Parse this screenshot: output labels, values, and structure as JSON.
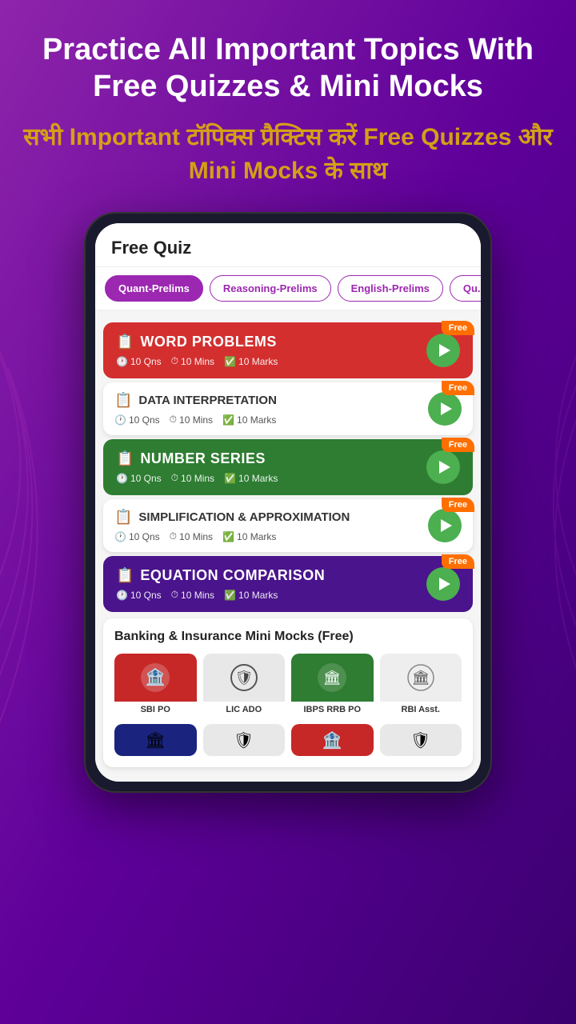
{
  "background": {
    "color_top": "#7b1fa2",
    "color_bottom": "#4a0080"
  },
  "header": {
    "headline_en": "Practice All Important Topics With Free Quizzes & Mini Mocks",
    "headline_hi": "सभी Important टॉपिक्स प्रैक्टिस करें Free Quizzes और Mini Mocks के साथ"
  },
  "phone": {
    "title": "Free Quiz",
    "tabs": [
      {
        "label": "Quant-Prelims",
        "active": true
      },
      {
        "label": "Reasoning-Prelims",
        "active": false
      },
      {
        "label": "English-Prelims",
        "active": false
      },
      {
        "label": "Qu...",
        "active": false
      }
    ],
    "quiz_items": [
      {
        "id": 1,
        "title": "WORD PROBLEMS",
        "style": "large-red",
        "qns": "10 Qns",
        "mins": "10 Mins",
        "marks": "10 Marks",
        "free": true
      },
      {
        "id": 2,
        "title": "DATA INTERPRETATION",
        "style": "small",
        "qns": "10 Qns",
        "mins": "10 Mins",
        "marks": "10 Marks",
        "free": true
      },
      {
        "id": 3,
        "title": "NUMBER SERIES",
        "style": "large-green",
        "qns": "10 Qns",
        "mins": "10 Mins",
        "marks": "10 Marks",
        "free": true
      },
      {
        "id": 4,
        "title": "SIMPLIFICATION & APPROXIMATION",
        "style": "small",
        "qns": "10 Qns",
        "mins": "10 Mins",
        "marks": "10 Marks",
        "free": true
      },
      {
        "id": 5,
        "title": "EQUATION COMPARISON",
        "style": "large-purple",
        "qns": "10 Qns",
        "mins": "10 Mins",
        "marks": "10 Marks",
        "free": true
      }
    ],
    "mini_mocks": {
      "title": "Banking & Insurance Mini Mocks (Free)",
      "items_row1": [
        {
          "label": "SBI PO",
          "color": "#c62828",
          "icon": "🏦"
        },
        {
          "label": "LIC ADO",
          "color": "#e8e8e8",
          "icon": "🛡️"
        },
        {
          "label": "IBPS RRB PO",
          "color": "#2e7d32",
          "icon": "🏛️"
        },
        {
          "label": "RBI Asst.",
          "color": "#eeeeee",
          "icon": "🏛️"
        }
      ],
      "items_row2": [
        {
          "label": "",
          "color": "#1a237e",
          "icon": "🏛️"
        },
        {
          "label": "",
          "color": "#eeeeee",
          "icon": "🏛️"
        },
        {
          "label": "",
          "color": "#c62828",
          "icon": "🏦"
        },
        {
          "label": "",
          "color": "#e8e8e8",
          "icon": "🛡️"
        }
      ]
    }
  },
  "labels": {
    "free": "Free",
    "play": "▶"
  }
}
